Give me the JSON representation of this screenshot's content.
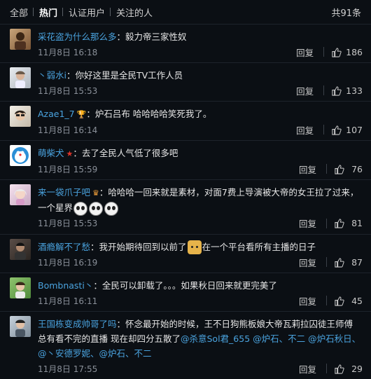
{
  "tabs": [
    {
      "label": "全部",
      "active": false
    },
    {
      "label": "热门",
      "active": true
    },
    {
      "label": "认证用户",
      "active": false
    },
    {
      "label": "关注的人",
      "active": false
    }
  ],
  "total": "共91条",
  "reply_label": "回复",
  "comments": [
    {
      "user": "采花盗为什么那么多",
      "sep": "：",
      "text": "毅力帝三家性奴",
      "time": "11月8日 16:18",
      "likes": "186"
    },
    {
      "user": "丶弱水i",
      "sep": "：",
      "text": "你好这里是全民TV工作人员",
      "time": "11月8日 15:53",
      "likes": "133"
    },
    {
      "user": "Azae1_7",
      "sep": "：",
      "text": "炉石吕布 哈哈哈哈笑死我了。",
      "time": "11月8日 16:14",
      "likes": "107"
    },
    {
      "user": "萌柴犬",
      "sep": "：",
      "text": "去了全民人气低了很多吧",
      "time": "11月8日 15:59",
      "likes": "76"
    },
    {
      "user": "来一袋爪子吧",
      "sep": "：",
      "text": "哈哈哈一回来就是素材，对面7费上导演被大帝的女王拉了过来，一个星界",
      "time": "11月8日 15:53",
      "likes": "81"
    },
    {
      "user": "酒瘾解不了愁",
      "sep": "：",
      "text_a": "我开始期待回到以前了",
      "text_b": "在一个平台看所有主播的日子",
      "time": "11月8日 16:19",
      "likes": "87"
    },
    {
      "user": "Bombnasti丶",
      "sep": "：",
      "text": "全民可以卸载了。。。如果秋日回来就更完美了",
      "time": "11月8日 16:11",
      "likes": "45"
    },
    {
      "user": "王国栋变成帅哥了吗",
      "sep": "：",
      "text": "怀念最开始的时候，王不日狗熊板娘大帝瓦莉拉囚徒王师傅 总有看不完的直播 现在却四分五散了",
      "mentions": [
        "@杀意Sol君_655",
        "@炉石、不二",
        "@炉石秋日、",
        "@丶安德罗妮、",
        "@炉石、不二"
      ],
      "time": "11月8日 17:55",
      "likes": "29"
    }
  ],
  "colors": {
    "background": "#0b0f14",
    "username": "#4aa3df",
    "time": "#8a9099"
  }
}
